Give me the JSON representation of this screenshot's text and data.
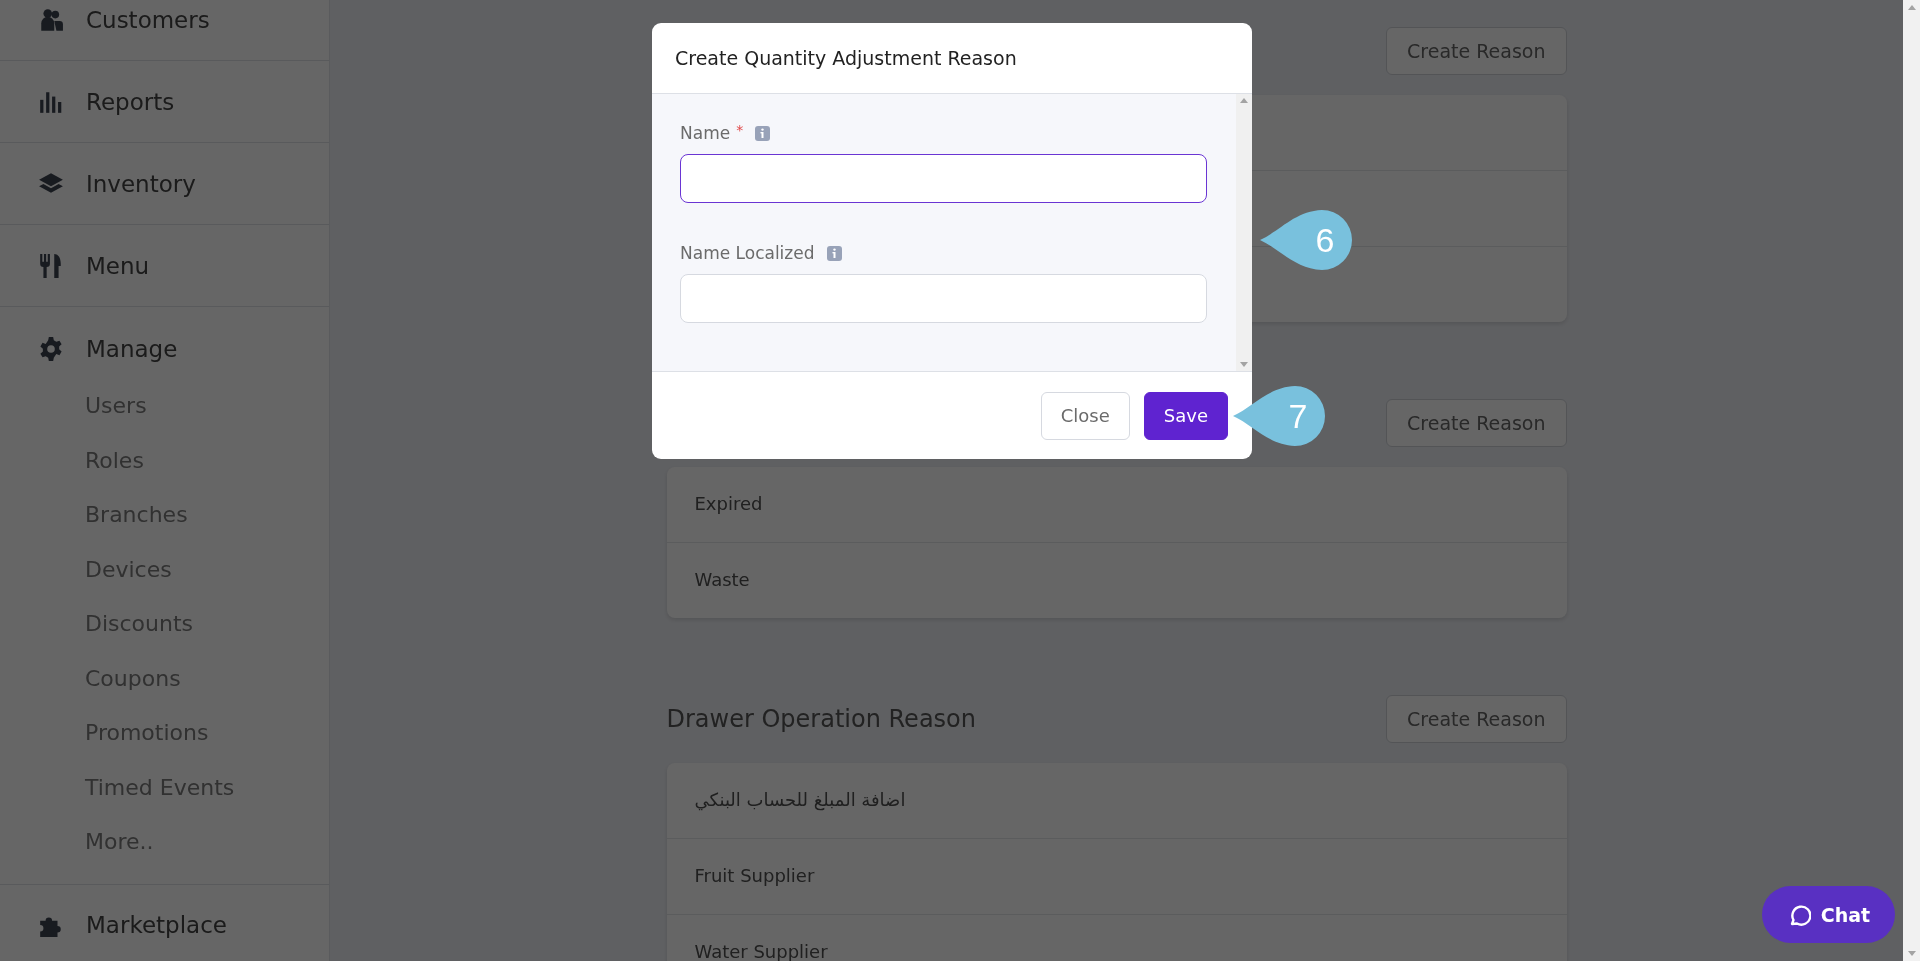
{
  "sidebar": {
    "items": [
      {
        "label": "Customers"
      },
      {
        "label": "Reports"
      },
      {
        "label": "Inventory"
      },
      {
        "label": "Menu"
      },
      {
        "label": "Manage",
        "children": [
          {
            "label": "Users"
          },
          {
            "label": "Roles"
          },
          {
            "label": "Branches"
          },
          {
            "label": "Devices"
          },
          {
            "label": "Discounts"
          },
          {
            "label": "Coupons"
          },
          {
            "label": "Promotions"
          },
          {
            "label": "Timed Events"
          },
          {
            "label": "More.."
          }
        ]
      },
      {
        "label": "Marketplace"
      }
    ]
  },
  "sections": [
    {
      "button": "Create Reason",
      "rows": [
        {},
        {},
        {}
      ]
    },
    {
      "button": "Create Reason",
      "rows": [
        {
          "label": "Expired"
        },
        {
          "label": "Waste"
        }
      ]
    },
    {
      "heading": "Drawer Operation Reason",
      "button": "Create Reason",
      "rows": [
        {
          "label": "اضافة المبلغ للحساب البنكي"
        },
        {
          "label": "Fruit Supplier"
        },
        {
          "label": "Water Supplier"
        }
      ]
    }
  ],
  "modal": {
    "title": "Create Quantity Adjustment Reason",
    "fields": [
      {
        "label": "Name",
        "required_mark": "*",
        "focused": true
      },
      {
        "label": "Name Localized",
        "focused": false
      }
    ],
    "buttons": [
      {
        "label": "Close",
        "kind": "secondary"
      },
      {
        "label": "Save",
        "kind": "primary"
      }
    ]
  },
  "callouts": [
    {
      "label": "6"
    },
    {
      "label": "7"
    }
  ],
  "chat": {
    "label": "Chat"
  }
}
